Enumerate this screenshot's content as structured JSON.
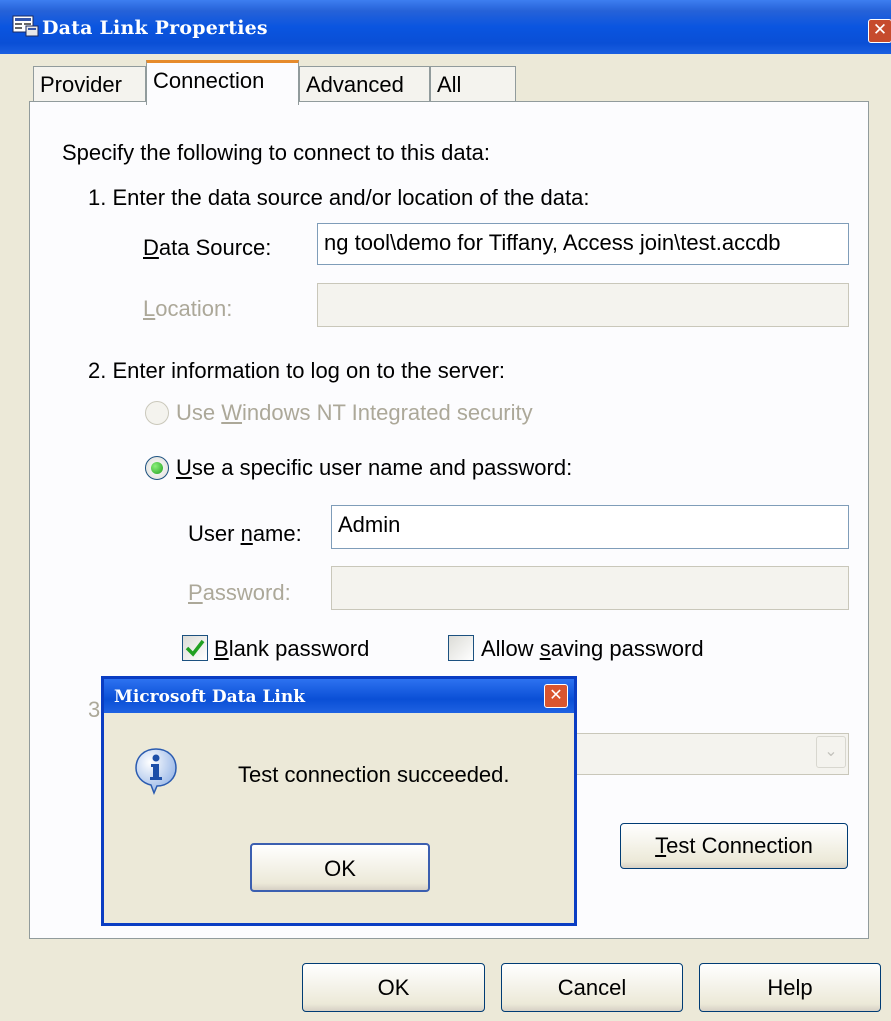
{
  "window": {
    "title": "Data Link Properties",
    "close_glyph": "✕",
    "icon": "data-link-icon"
  },
  "tabs": [
    {
      "label": "Provider",
      "active": false
    },
    {
      "label": "Connection",
      "active": true
    },
    {
      "label": "Advanced",
      "active": false
    },
    {
      "label": "All",
      "active": false
    }
  ],
  "connection": {
    "intro": "Specify the following to connect to this data:",
    "step1": "1. Enter the data source and/or location of the data:",
    "data_source_label": "Data Source:",
    "data_source_value": "ng tool\\demo for Tiffany, Access join\\test.accdb",
    "location_label": "Location:",
    "location_value": "",
    "step2": "2. Enter information to log on to the server:",
    "radio_nt_label": "Use Windows NT Integrated security",
    "radio_specific_label": "Use a specific user name and password:",
    "username_label": "User name:",
    "username_value": "Admin",
    "password_label": "Password:",
    "password_value": "",
    "blank_password_label": "Blank password",
    "blank_password_checked": true,
    "allow_saving_label": "Allow saving password",
    "allow_saving_checked": false,
    "step3_fragment": "3",
    "test_connection_label": "Test Connection"
  },
  "footer": {
    "ok_label": "OK",
    "cancel_label": "Cancel",
    "help_label": "Help"
  },
  "message_box": {
    "title": "Microsoft Data Link",
    "icon": "info-icon",
    "message": "Test connection succeeded.",
    "ok_label": "OK",
    "close_glyph": "✕"
  },
  "colors": {
    "titlebar": "#0a55e0",
    "dialog_bg": "#ece9d8",
    "panel_bg": "#fcfcfe",
    "active_tab_accent": "#e68b2c",
    "close_button": "#c64b2d",
    "check_green": "#21a121"
  }
}
